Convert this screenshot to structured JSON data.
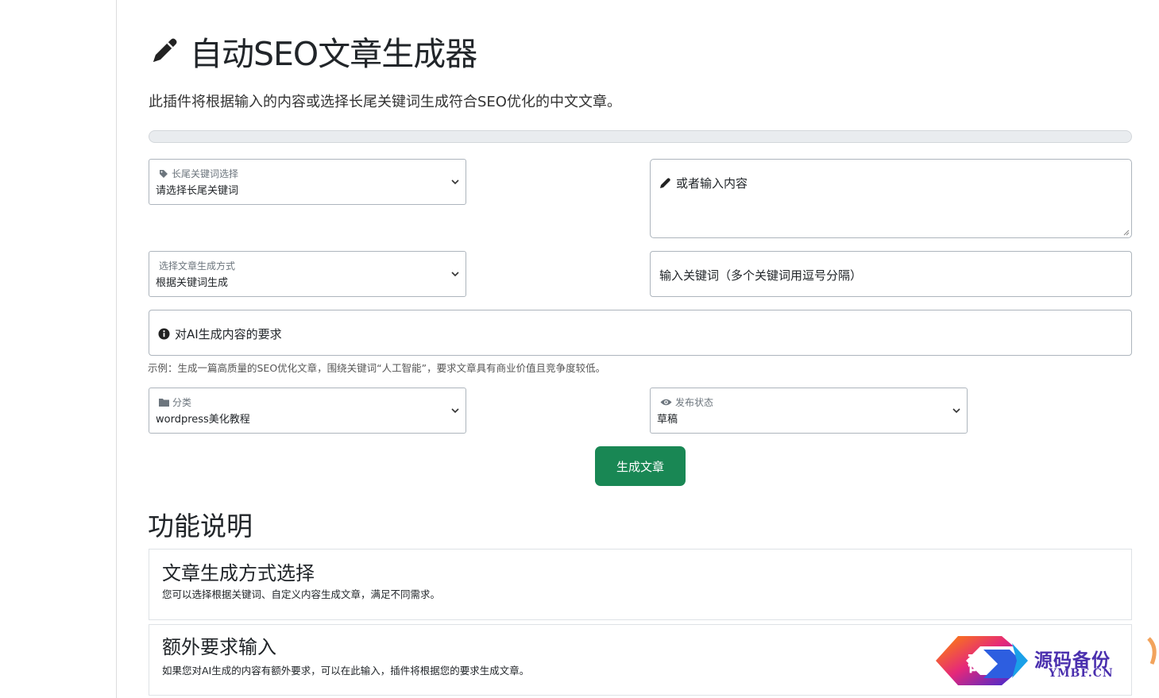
{
  "header": {
    "title": "自动SEO文章生成器",
    "intro": "此插件将根据输入的内容或选择长尾关键词生成符合SEO优化的中文文章。"
  },
  "progress": {
    "value": 0
  },
  "form": {
    "longtail": {
      "label": "长尾关键词选择",
      "value": "请选择长尾关键词"
    },
    "content": {
      "placeholder": "或者输入内容"
    },
    "method": {
      "label": "选择文章生成方式",
      "value": "根据关键词生成"
    },
    "keywords": {
      "placeholder": "输入关键词（多个关键词用逗号分隔）"
    },
    "requirements": {
      "placeholder": "对AI生成内容的要求",
      "help": "示例：生成一篇高质量的SEO优化文章，围绕关键词“人工智能”，要求文章具有商业价值且竞争度较低。"
    },
    "category": {
      "label": "分类",
      "value": "wordpress美化教程"
    },
    "status": {
      "label": "发布状态",
      "value": "草稿"
    },
    "submit_label": "生成文章"
  },
  "features": {
    "title": "功能说明",
    "cards": [
      {
        "title": "文章生成方式选择",
        "text": "您可以选择根据关键词、自定义内容生成文章，满足不同需求。"
      },
      {
        "title": "额外要求输入",
        "text": "如果您对AI生成的内容有额外要求，可以在此输入，插件将根据您的要求生成文章。"
      }
    ]
  },
  "watermark": {
    "char": "码",
    "cn": "源码备份",
    "en": "YMBF.CN"
  },
  "colors": {
    "primary_button": "#198754",
    "progress_track": "#e9ecef",
    "watermark": "#4a2fae"
  }
}
